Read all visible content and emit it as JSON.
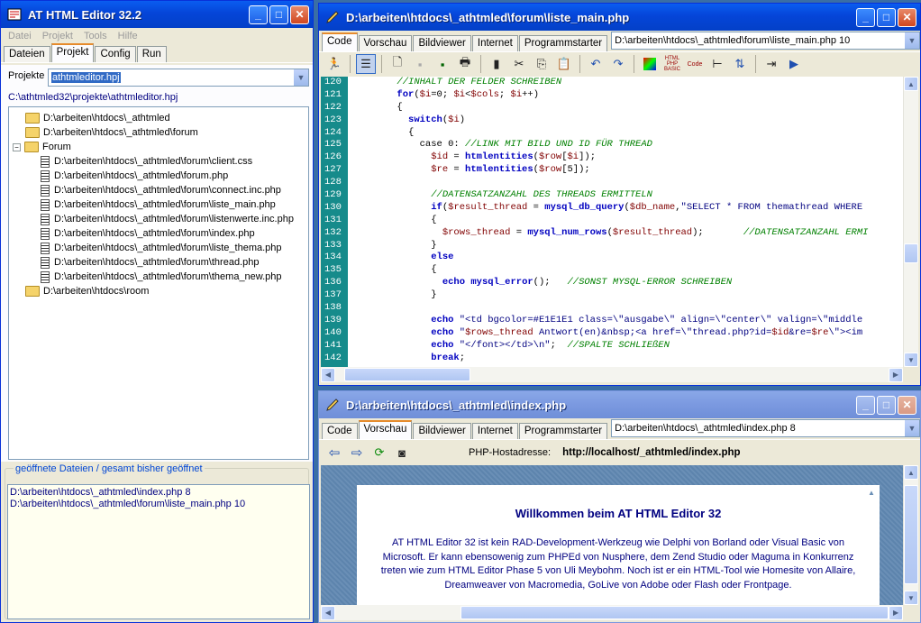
{
  "left": {
    "title": "AT HTML Editor 32.2",
    "menu": [
      "Datei",
      "Projekt",
      "Tools",
      "Hilfe"
    ],
    "tabs": [
      "Dateien",
      "Projekt",
      "Config",
      "Run"
    ],
    "project_label": "Projekte",
    "project_value": "athtmleditor.hpj",
    "project_path": "C:\\athtmled32\\projekte\\athtmleditor.hpj",
    "tree": [
      {
        "t": "D:\\arbeiten\\htdocs\\_athtmled",
        "k": "folder",
        "lvl": 0
      },
      {
        "t": "D:\\arbeiten\\htdocs\\_athtmled\\forum",
        "k": "folder",
        "lvl": 0
      },
      {
        "t": "Forum",
        "k": "folder-open",
        "lvl": 0
      },
      {
        "t": "D:\\arbeiten\\htdocs\\_athtmled\\forum\\client.css",
        "k": "file",
        "lvl": 1
      },
      {
        "t": "D:\\arbeiten\\htdocs\\_athtmled\\forum.php",
        "k": "file",
        "lvl": 1
      },
      {
        "t": "D:\\arbeiten\\htdocs\\_athtmled\\forum\\connect.inc.php",
        "k": "file",
        "lvl": 1
      },
      {
        "t": "D:\\arbeiten\\htdocs\\_athtmled\\forum\\liste_main.php",
        "k": "file",
        "lvl": 1
      },
      {
        "t": "D:\\arbeiten\\htdocs\\_athtmled\\forum\\listenwerte.inc.php",
        "k": "file",
        "lvl": 1
      },
      {
        "t": "D:\\arbeiten\\htdocs\\_athtmled\\forum\\index.php",
        "k": "file",
        "lvl": 1
      },
      {
        "t": "D:\\arbeiten\\htdocs\\_athtmled\\forum\\liste_thema.php",
        "k": "file",
        "lvl": 1
      },
      {
        "t": "D:\\arbeiten\\htdocs\\_athtmled\\forum\\thread.php",
        "k": "file",
        "lvl": 1
      },
      {
        "t": "D:\\arbeiten\\htdocs\\_athtmled\\forum\\thema_new.php",
        "k": "file",
        "lvl": 1
      },
      {
        "t": "D:\\arbeiten\\htdocs\\room",
        "k": "folder",
        "lvl": 0
      }
    ],
    "open_group": "geöffnete Dateien / gesamt bisher geöffnet",
    "open_files": [
      "D:\\arbeiten\\htdocs\\_athtmled\\index.php 8",
      "D:\\arbeiten\\htdocs\\_athtmled\\forum\\liste_main.php 10"
    ]
  },
  "editor": {
    "title": "D:\\arbeiten\\htdocs\\_athtmled\\forum\\liste_main.php",
    "tabs": [
      "Code",
      "Vorschau",
      "Bildviewer",
      "Internet",
      "Programmstarter"
    ],
    "file_combo": "D:\\arbeiten\\htdocs\\_athtmled\\forum\\liste_main.php 10",
    "lines": [
      {
        "n": "120",
        "h": "        <span class='cm'>//INHALT DER FELDER SCHREIBEN</span>"
      },
      {
        "n": "121",
        "h": "        <span class='kw'>for</span>(<span class='vr'>$i</span>=0; <span class='vr'>$i</span>&lt;<span class='vr'>$cols</span>; <span class='vr'>$i</span>++)"
      },
      {
        "n": "122",
        "h": "        {"
      },
      {
        "n": "123",
        "h": "          <span class='kw'>switch</span>(<span class='vr'>$i</span>)"
      },
      {
        "n": "124",
        "h": "          {"
      },
      {
        "n": "125",
        "h": "            case 0: <span class='cm'>//LINK MIT BILD UND ID FÜR THREAD</span>"
      },
      {
        "n": "126",
        "h": "              <span class='vr'>$id</span> = <span class='kw'>htmlentities</span>(<span class='vr'>$row</span>[<span class='vr'>$i</span>]);"
      },
      {
        "n": "127",
        "h": "              <span class='vr'>$re</span> = <span class='kw'>htmlentities</span>(<span class='vr'>$row</span>[5]);"
      },
      {
        "n": "128",
        "h": ""
      },
      {
        "n": "129",
        "h": "              <span class='cm'>//DATENSATZANZAHL DES THREADS ERMITTELN</span>"
      },
      {
        "n": "130",
        "h": "              <span class='kw'>if</span>(<span class='vr'>$result_thread</span> = <span class='kw'>mysql_db_query</span>(<span class='vr'>$db_name</span>,<span class='st'>\"SELECT * FROM themathread WHERE</span>"
      },
      {
        "n": "131",
        "h": "              {"
      },
      {
        "n": "132",
        "h": "                <span class='vr'>$rows_thread</span> = <span class='kw'>mysql_num_rows</span>(<span class='vr'>$result_thread</span>);       <span class='cm'>//DATENSATZANZAHL ERMI</span>"
      },
      {
        "n": "133",
        "h": "              }"
      },
      {
        "n": "134",
        "h": "              <span class='kw'>else</span>"
      },
      {
        "n": "135",
        "h": "              {"
      },
      {
        "n": "136",
        "h": "                <span class='kw'>echo</span> <span class='kw'>mysql_error</span>();   <span class='cm'>//SONST MYSQL-ERROR SCHREIBEN</span>"
      },
      {
        "n": "137",
        "h": "              }"
      },
      {
        "n": "138",
        "h": ""
      },
      {
        "n": "139",
        "h": "              <span class='kw'>echo</span> <span class='st'>\"&lt;td bgcolor=#E1E1E1 class=\\\"ausgabe\\\" align=\\\"center\\\" valign=\\\"middle</span>"
      },
      {
        "n": "140",
        "h": "              <span class='kw'>echo</span> <span class='st'>\"<span class='vr'>$rows_thread</span> Antwort(en)&amp;nbsp;&lt;a href=\\\"thread.php?id=<span class='vr'>$id</span>&amp;re=<span class='vr'>$re</span>\\\"&gt;&lt;im</span>"
      },
      {
        "n": "141",
        "h": "              <span class='kw'>echo</span> <span class='st'>\"&lt;/font&gt;&lt;/td&gt;\\n\"</span>;  <span class='cm'>//SPALTE SCHLIEßEN</span>"
      },
      {
        "n": "142",
        "h": "              <span class='kw'>break</span>;"
      }
    ]
  },
  "preview": {
    "title": "D:\\arbeiten\\htdocs\\_athtmled\\index.php",
    "tabs": [
      "Code",
      "Vorschau",
      "Bildviewer",
      "Internet",
      "Programmstarter"
    ],
    "file_combo": "D:\\arbeiten\\htdocs\\_athtmled\\index.php 8",
    "host_label": "PHP-Hostadresse:",
    "host_url": "http://localhost/_athtmled/index.php",
    "page_title": "Willkommen beim AT HTML Editor 32",
    "page_text": "AT HTML Editor 32 ist kein RAD-Development-Werkzeug wie Delphi von Borland oder Visual Basic von Microsoft. Er kann ebensowenig zum PHPEd von Nusphere, dem Zend Studio oder Maguma in Konkurrenz treten wie zum HTML Editor Phase 5 von Uli Meybohm. Noch ist er ein HTML-Tool wie Homesite von Allaire, Dreamweaver von Macromedia, GoLive von Adobe oder Flash oder Frontpage."
  }
}
